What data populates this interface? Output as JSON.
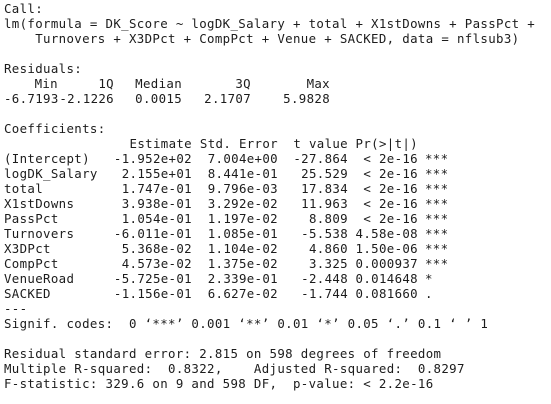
{
  "call": {
    "label": "Call:",
    "line1": "lm(formula = DK_Score ~ logDK_Salary + total + X1stDowns + PassPct +",
    "line2": "    Turnovers + X3DPct + CompPct + Venue + SACKED, data = nflsub3)"
  },
  "residuals": {
    "label": "Residuals:",
    "headers": [
      "Min",
      "1Q",
      "Median",
      "3Q",
      "Max"
    ],
    "values": [
      "-6.7193",
      "-2.1226",
      "0.0015",
      "2.1707",
      "5.9828"
    ]
  },
  "coefficients": {
    "label": "Coefficients:",
    "headers": {
      "estimate": "Estimate",
      "std_error": "Std. Error",
      "t_value": "t value",
      "p_value": "Pr(>|t|)"
    },
    "rows": [
      {
        "name": "(Intercept)",
        "estimate": "-1.952e+02",
        "std_error": "7.004e+00",
        "t_value": "-27.864",
        "p_value": "< 2e-16",
        "signif": "***"
      },
      {
        "name": "logDK_Salary",
        "estimate": "2.155e+01",
        "std_error": "8.441e-01",
        "t_value": "25.529",
        "p_value": "< 2e-16",
        "signif": "***"
      },
      {
        "name": "total",
        "estimate": "1.747e-01",
        "std_error": "9.796e-03",
        "t_value": "17.834",
        "p_value": "< 2e-16",
        "signif": "***"
      },
      {
        "name": "X1stDowns",
        "estimate": "3.938e-01",
        "std_error": "3.292e-02",
        "t_value": "11.963",
        "p_value": "< 2e-16",
        "signif": "***"
      },
      {
        "name": "PassPct",
        "estimate": "1.054e-01",
        "std_error": "1.197e-02",
        "t_value": "8.809",
        "p_value": "< 2e-16",
        "signif": "***"
      },
      {
        "name": "Turnovers",
        "estimate": "-6.011e-01",
        "std_error": "1.085e-01",
        "t_value": "-5.538",
        "p_value": "4.58e-08",
        "signif": "***"
      },
      {
        "name": "X3DPct",
        "estimate": "5.368e-02",
        "std_error": "1.104e-02",
        "t_value": "4.860",
        "p_value": "1.50e-06",
        "signif": "***"
      },
      {
        "name": "CompPct",
        "estimate": "4.573e-02",
        "std_error": "1.375e-02",
        "t_value": "3.325",
        "p_value": "0.000937",
        "signif": "***"
      },
      {
        "name": "VenueRoad",
        "estimate": "-5.725e-01",
        "std_error": "2.339e-01",
        "t_value": "-2.448",
        "p_value": "0.014648",
        "signif": "*"
      },
      {
        "name": "SACKED",
        "estimate": "-1.156e-01",
        "std_error": "6.627e-02",
        "t_value": "-1.744",
        "p_value": "0.081660",
        "signif": "."
      }
    ],
    "separator": "---",
    "signif_codes": "Signif. codes:  0 ‘***’ 0.001 ‘**’ 0.01 ‘*’ 0.05 ‘.’ 0.1 ‘ ’ 1"
  },
  "summary": {
    "residual_se": "Residual standard error: 2.815 on 598 degrees of freedom",
    "r_squared": "Multiple R-squared:  0.8322,\tAdjusted R-squared:  0.8297 ",
    "f_statistic": "F-statistic: 329.6 on 9 and 598 DF,  p-value: < 2.2e-16"
  }
}
